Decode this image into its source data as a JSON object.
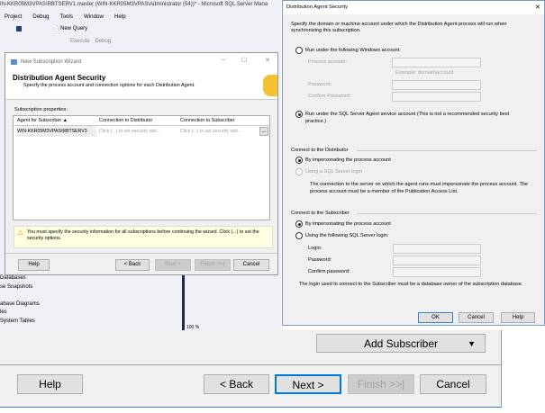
{
  "ssms": {
    "title": "IN-KKR05M3VPAS\\RBTSERV1.master (WIN-KKR05M3VPAS\\Administrator (54))* - Microsoft SQL Server Mana",
    "menu": [
      "Project",
      "Debug",
      "Tools",
      "Window",
      "Help"
    ],
    "toolbar": {
      "new_query": "New Query",
      "execute": "Execute",
      "debug": "Debug"
    },
    "tree": [
      "Databases",
      "se Snapshots",
      "abase Diagrams",
      "les",
      "System Tables"
    ],
    "zoom": "100 %"
  },
  "wizard": {
    "title": "New Subscription Wizard",
    "header": "Distribution Agent Security",
    "subtitle": "Specify the process account and connection options for each Distribution Agent.",
    "grid_label": "Subscription properties:",
    "columns": [
      "Agent for Subscriber",
      "Connection to Distributor",
      "Connection to Subscriber"
    ],
    "rows": [
      [
        "WIN-KKR05M3VPAS\\RBTSERV3",
        "Click (...) to set security opti...",
        "Click (...) to set security opti..."
      ]
    ],
    "ellipsis": "...",
    "warning": "You must specify the security information for all subscriptions before continuing the wizard. Click (...) to set the security options.",
    "buttons": {
      "help": "Help",
      "back": "< Back",
      "next": "Next >",
      "finish": "Finish >>|",
      "cancel": "Cancel"
    }
  },
  "dialog": {
    "title": "Distribution Agent Security",
    "intro": "Specify the domain or machine account under which the Distribution Agent process will run when synchronizing this subscription.",
    "run_windows": "Run under the following Windows account:",
    "process_account": "Process account:",
    "example": "Example: domain\\account",
    "password": "Password:",
    "confirm_password": "Confirm Password:",
    "run_agent": "Run under the SQL Server Agent service account (This is not a recommended security best practice.)",
    "dist_group": "Connect to the Distributor",
    "dist_impersonate": "By impersonating the process account",
    "dist_sql": "Using a SQL Server login",
    "dist_note": "The connection to the server on which the agent runs must impersonate the process account. The process account must be a member of the Publication Access List.",
    "sub_group": "Connect to the Subscriber",
    "sub_impersonate": "By impersonating the process account",
    "sub_sql": "Using the following SQL Server login:",
    "login": "Login:",
    "sub_password": "Password:",
    "sub_confirm": "Confirm password:",
    "sub_note": "The login used to connect to the Subscriber must be a database owner of the subscription database.",
    "ok": "OK",
    "cancel": "Cancel",
    "help": "Help"
  },
  "bottom": {
    "add_subscriber": "Add Subscriber",
    "help": "Help",
    "back": "< Back",
    "next": "Next >",
    "finish": "Finish >>|",
    "cancel": "Cancel"
  }
}
